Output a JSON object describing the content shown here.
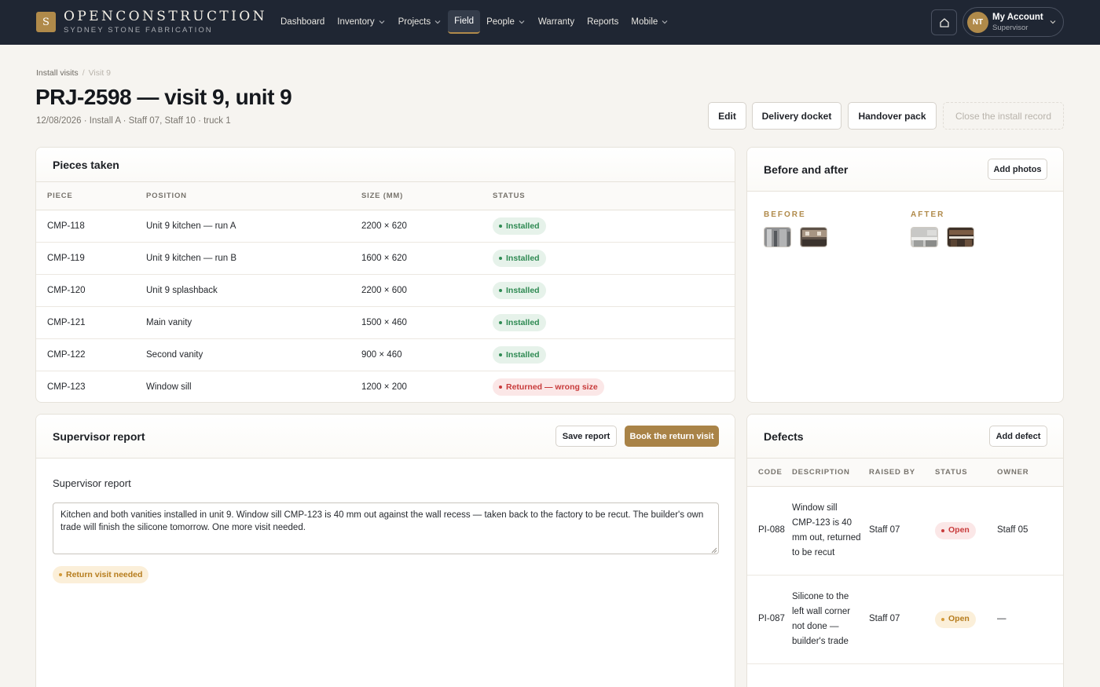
{
  "brand": {
    "mark": "S",
    "name": "OPENCONSTRUCTION",
    "sub": "SYDNEY STONE FABRICATION"
  },
  "nav": [
    {
      "label": "Dashboard",
      "dropdown": false,
      "active": false
    },
    {
      "label": "Inventory",
      "dropdown": true,
      "active": false
    },
    {
      "label": "Projects",
      "dropdown": true,
      "active": false
    },
    {
      "label": "Field",
      "dropdown": false,
      "active": true
    },
    {
      "label": "People",
      "dropdown": true,
      "active": false
    },
    {
      "label": "Warranty",
      "dropdown": false,
      "active": false
    },
    {
      "label": "Reports",
      "dropdown": false,
      "active": false
    },
    {
      "label": "Mobile",
      "dropdown": true,
      "active": false
    }
  ],
  "account": {
    "initials": "NT",
    "name": "My Account",
    "role": "Supervisor"
  },
  "breadcrumb": {
    "parent": "Install visits",
    "separator": "/",
    "current": "Visit 9"
  },
  "page": {
    "title": "PRJ-2598 — visit 9, unit 9",
    "meta": "12/08/2026 · Install A · Staff 07, Staff 10 · truck 1"
  },
  "actions": {
    "edit": "Edit",
    "delivery_docket": "Delivery docket",
    "handover_pack": "Handover pack",
    "close_record": "Close the install record"
  },
  "pieces": {
    "title": "Pieces taken",
    "columns": [
      "PIECE",
      "POSITION",
      "SIZE (MM)",
      "STATUS"
    ],
    "rows": [
      {
        "piece": "CMP-118",
        "position": "Unit 9 kitchen — run A",
        "size": "2200 × 620",
        "status": "Installed",
        "tone": "green"
      },
      {
        "piece": "CMP-119",
        "position": "Unit 9 kitchen — run B",
        "size": "1600 × 620",
        "status": "Installed",
        "tone": "green"
      },
      {
        "piece": "CMP-120",
        "position": "Unit 9 splashback",
        "size": "2200 × 600",
        "status": "Installed",
        "tone": "green"
      },
      {
        "piece": "CMP-121",
        "position": "Main vanity",
        "size": "1500 × 460",
        "status": "Installed",
        "tone": "green"
      },
      {
        "piece": "CMP-122",
        "position": "Second vanity",
        "size": "900 × 460",
        "status": "Installed",
        "tone": "green"
      },
      {
        "piece": "CMP-123",
        "position": "Window sill",
        "size": "1200 × 200",
        "status": "Returned — wrong size",
        "tone": "red"
      }
    ]
  },
  "photos": {
    "title": "Before and after",
    "add_label": "Add photos",
    "before_label": "BEFORE",
    "after_label": "AFTER"
  },
  "report": {
    "title": "Supervisor report",
    "save_label": "Save report",
    "book_label": "Book the return visit",
    "field_label": "Supervisor report",
    "text": "Kitchen and both vanities installed in unit 9. Window sill CMP-123 is 40 mm out against the wall recess — taken back to the factory to be recut. The builder's own trade will finish the silicone tomorrow. One more visit needed.",
    "badge": "Return visit needed"
  },
  "defects": {
    "title": "Defects",
    "add_label": "Add defect",
    "columns": [
      "CODE",
      "DESCRIPTION",
      "RAISED BY",
      "STATUS",
      "OWNER"
    ],
    "rows": [
      {
        "code": "PI-088",
        "description": "Window sill CMP-123 is 40 mm out, returned to be recut",
        "raised_by": "Staff 07",
        "status": "Open",
        "tone": "red",
        "owner": "Staff 05"
      },
      {
        "code": "PI-087",
        "description": "Silicone to the left wall corner not done — builder's trade",
        "raised_by": "Staff 07",
        "status": "Open",
        "tone": "amber",
        "owner": "—"
      }
    ]
  }
}
